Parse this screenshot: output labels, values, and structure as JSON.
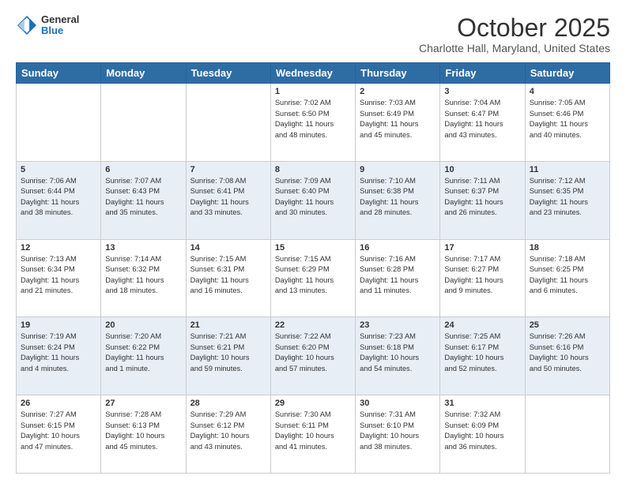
{
  "header": {
    "logo_general": "General",
    "logo_blue": "Blue",
    "month_title": "October 2025",
    "location": "Charlotte Hall, Maryland, United States"
  },
  "days_of_week": [
    "Sunday",
    "Monday",
    "Tuesday",
    "Wednesday",
    "Thursday",
    "Friday",
    "Saturday"
  ],
  "weeks": [
    [
      {
        "day": "",
        "info": ""
      },
      {
        "day": "",
        "info": ""
      },
      {
        "day": "",
        "info": ""
      },
      {
        "day": "1",
        "info": "Sunrise: 7:02 AM\nSunset: 6:50 PM\nDaylight: 11 hours\nand 48 minutes."
      },
      {
        "day": "2",
        "info": "Sunrise: 7:03 AM\nSunset: 6:49 PM\nDaylight: 11 hours\nand 45 minutes."
      },
      {
        "day": "3",
        "info": "Sunrise: 7:04 AM\nSunset: 6:47 PM\nDaylight: 11 hours\nand 43 minutes."
      },
      {
        "day": "4",
        "info": "Sunrise: 7:05 AM\nSunset: 6:46 PM\nDaylight: 11 hours\nand 40 minutes."
      }
    ],
    [
      {
        "day": "5",
        "info": "Sunrise: 7:06 AM\nSunset: 6:44 PM\nDaylight: 11 hours\nand 38 minutes."
      },
      {
        "day": "6",
        "info": "Sunrise: 7:07 AM\nSunset: 6:43 PM\nDaylight: 11 hours\nand 35 minutes."
      },
      {
        "day": "7",
        "info": "Sunrise: 7:08 AM\nSunset: 6:41 PM\nDaylight: 11 hours\nand 33 minutes."
      },
      {
        "day": "8",
        "info": "Sunrise: 7:09 AM\nSunset: 6:40 PM\nDaylight: 11 hours\nand 30 minutes."
      },
      {
        "day": "9",
        "info": "Sunrise: 7:10 AM\nSunset: 6:38 PM\nDaylight: 11 hours\nand 28 minutes."
      },
      {
        "day": "10",
        "info": "Sunrise: 7:11 AM\nSunset: 6:37 PM\nDaylight: 11 hours\nand 26 minutes."
      },
      {
        "day": "11",
        "info": "Sunrise: 7:12 AM\nSunset: 6:35 PM\nDaylight: 11 hours\nand 23 minutes."
      }
    ],
    [
      {
        "day": "12",
        "info": "Sunrise: 7:13 AM\nSunset: 6:34 PM\nDaylight: 11 hours\nand 21 minutes."
      },
      {
        "day": "13",
        "info": "Sunrise: 7:14 AM\nSunset: 6:32 PM\nDaylight: 11 hours\nand 18 minutes."
      },
      {
        "day": "14",
        "info": "Sunrise: 7:15 AM\nSunset: 6:31 PM\nDaylight: 11 hours\nand 16 minutes."
      },
      {
        "day": "15",
        "info": "Sunrise: 7:15 AM\nSunset: 6:29 PM\nDaylight: 11 hours\nand 13 minutes."
      },
      {
        "day": "16",
        "info": "Sunrise: 7:16 AM\nSunset: 6:28 PM\nDaylight: 11 hours\nand 11 minutes."
      },
      {
        "day": "17",
        "info": "Sunrise: 7:17 AM\nSunset: 6:27 PM\nDaylight: 11 hours\nand 9 minutes."
      },
      {
        "day": "18",
        "info": "Sunrise: 7:18 AM\nSunset: 6:25 PM\nDaylight: 11 hours\nand 6 minutes."
      }
    ],
    [
      {
        "day": "19",
        "info": "Sunrise: 7:19 AM\nSunset: 6:24 PM\nDaylight: 11 hours\nand 4 minutes."
      },
      {
        "day": "20",
        "info": "Sunrise: 7:20 AM\nSunset: 6:22 PM\nDaylight: 11 hours\nand 1 minute."
      },
      {
        "day": "21",
        "info": "Sunrise: 7:21 AM\nSunset: 6:21 PM\nDaylight: 10 hours\nand 59 minutes."
      },
      {
        "day": "22",
        "info": "Sunrise: 7:22 AM\nSunset: 6:20 PM\nDaylight: 10 hours\nand 57 minutes."
      },
      {
        "day": "23",
        "info": "Sunrise: 7:23 AM\nSunset: 6:18 PM\nDaylight: 10 hours\nand 54 minutes."
      },
      {
        "day": "24",
        "info": "Sunrise: 7:25 AM\nSunset: 6:17 PM\nDaylight: 10 hours\nand 52 minutes."
      },
      {
        "day": "25",
        "info": "Sunrise: 7:26 AM\nSunset: 6:16 PM\nDaylight: 10 hours\nand 50 minutes."
      }
    ],
    [
      {
        "day": "26",
        "info": "Sunrise: 7:27 AM\nSunset: 6:15 PM\nDaylight: 10 hours\nand 47 minutes."
      },
      {
        "day": "27",
        "info": "Sunrise: 7:28 AM\nSunset: 6:13 PM\nDaylight: 10 hours\nand 45 minutes."
      },
      {
        "day": "28",
        "info": "Sunrise: 7:29 AM\nSunset: 6:12 PM\nDaylight: 10 hours\nand 43 minutes."
      },
      {
        "day": "29",
        "info": "Sunrise: 7:30 AM\nSunset: 6:11 PM\nDaylight: 10 hours\nand 41 minutes."
      },
      {
        "day": "30",
        "info": "Sunrise: 7:31 AM\nSunset: 6:10 PM\nDaylight: 10 hours\nand 38 minutes."
      },
      {
        "day": "31",
        "info": "Sunrise: 7:32 AM\nSunset: 6:09 PM\nDaylight: 10 hours\nand 36 minutes."
      },
      {
        "day": "",
        "info": ""
      }
    ]
  ]
}
